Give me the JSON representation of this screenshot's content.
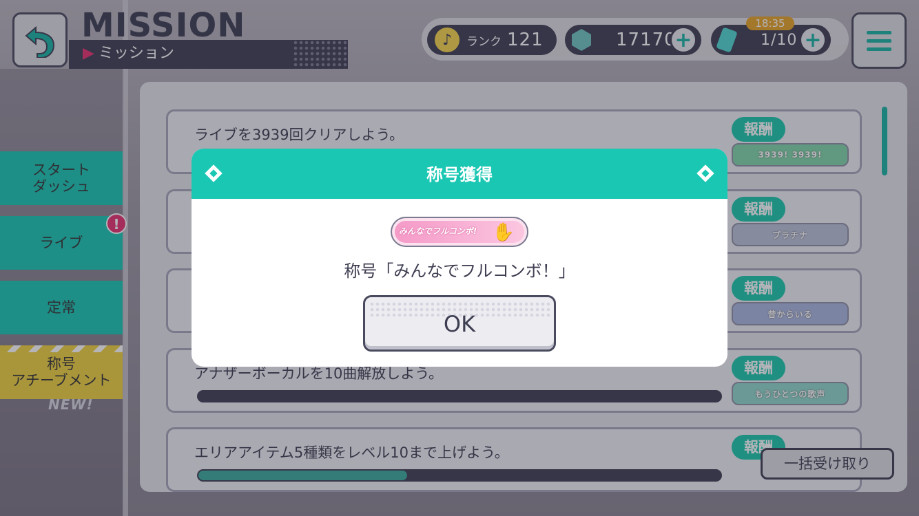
{
  "header": {
    "title_en": "MISSION",
    "title_jp": "ミッション",
    "rank_label": "ランク",
    "rank_value": "121",
    "gems": "17170",
    "energy": "1/10",
    "energy_timer": "18:35",
    "plus_symbol": "+",
    "back_icon": "back-arrow-icon",
    "menu_icon": "hamburger-menu-icon"
  },
  "sidebar": {
    "items": [
      {
        "label": "スタート\nダッシュ"
      },
      {
        "label": "ライブ"
      },
      {
        "label": "定常"
      },
      {
        "label": "称号\nアチーブメント"
      }
    ],
    "alert": "!",
    "new_tag": "NEW!"
  },
  "missions": [
    {
      "text": "ライブを3939回クリアしよう。",
      "reward_label": "報酬",
      "reward": "3939!  3939!"
    },
    {
      "text": "",
      "reward_label": "報酬",
      "reward": "プラチナ"
    },
    {
      "text": "",
      "reward_label": "報酬",
      "reward": "昔からいる"
    },
    {
      "text": "アナザーボーカルを10曲解放しよう。",
      "reward_label": "報酬",
      "reward": "もうひとつの歌声",
      "progress": 0.0
    },
    {
      "text": "エリアアイテム5種類をレベル10まで上げよう。",
      "reward_label": "報酬",
      "reward": "",
      "progress": 0.4
    }
  ],
  "collect_all": "一括受け取り",
  "dialog": {
    "title": "称号獲得",
    "badge_text": "みんなでフルコンボ!",
    "message": "称号「みんなでフルコンボ！」",
    "ok": "OK"
  },
  "colors": {
    "accent": "#19c7b3",
    "dark": "#3e3e52",
    "gold": "#e7a326",
    "alert": "#e8306f"
  }
}
